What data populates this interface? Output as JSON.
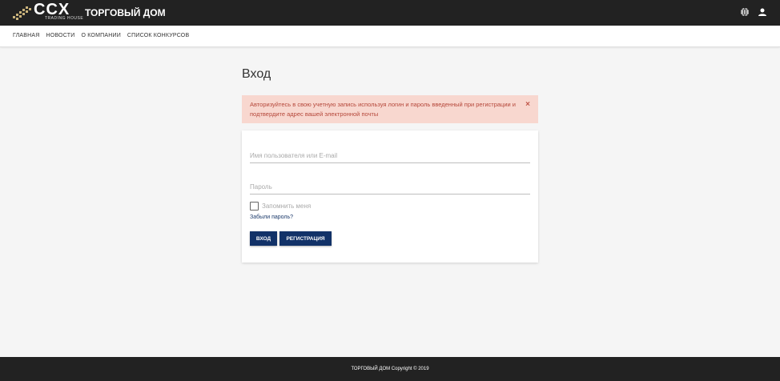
{
  "header": {
    "logo_text": "CCX",
    "logo_subtext": "TRADING HOUSE",
    "brand": "ТОРГОВЫЙ ДОМ",
    "icons": [
      "globe-icon",
      "user-icon"
    ]
  },
  "nav": {
    "items": [
      {
        "label": "ГЛАВНАЯ"
      },
      {
        "label": "НОВОСТИ"
      },
      {
        "label": "О КОМПАНИИ"
      },
      {
        "label": "СПИСОК КОНКУРСОВ"
      }
    ]
  },
  "login": {
    "title": "Вход",
    "alert_text": "Авторизуйтесь в свою учетную запись используя логин и пароль введенный при регистрации и подтвердите адрес вашей электронной почты",
    "alert_close": "×",
    "username_placeholder": "Имя пользователя или E-mail",
    "password_placeholder": "Пароль",
    "remember_label": "Запомнить меня",
    "forgot_label": "Забыли пароль?",
    "login_button": "Вход",
    "register_button": "Регистрация"
  },
  "footer": {
    "text": "ТОРГОВЫЙ ДОМ Copyright © 2019"
  },
  "colors": {
    "header_bg": "#222222",
    "alert_bg": "#f8d7cf",
    "alert_text": "#b5473a",
    "button_bg": "#123268"
  }
}
